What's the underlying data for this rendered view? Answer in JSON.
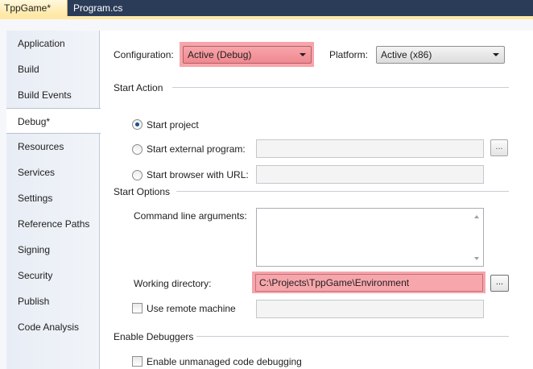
{
  "tabs": [
    {
      "label": "TppGame*",
      "active": true
    },
    {
      "label": "Program.cs",
      "active": false
    }
  ],
  "nav": {
    "items": [
      {
        "label": "Application"
      },
      {
        "label": "Build"
      },
      {
        "label": "Build Events"
      },
      {
        "label": "Debug*",
        "selected": true
      },
      {
        "label": "Resources"
      },
      {
        "label": "Services"
      },
      {
        "label": "Settings"
      },
      {
        "label": "Reference Paths"
      },
      {
        "label": "Signing"
      },
      {
        "label": "Security"
      },
      {
        "label": "Publish"
      },
      {
        "label": "Code Analysis"
      }
    ]
  },
  "config": {
    "configuration_label": "Configuration:",
    "configuration_value": "Active (Debug)",
    "platform_label": "Platform:",
    "platform_value": "Active (x86)"
  },
  "start_action": {
    "title": "Start Action",
    "start_project": "Start project",
    "start_external": "Start external program:",
    "start_browser": "Start browser with URL:",
    "browse_label": "..."
  },
  "start_options": {
    "title": "Start Options",
    "cmd_args_label": "Command line arguments:",
    "cmd_args_value": "",
    "working_dir_label": "Working directory:",
    "working_dir_value": "C:\\Projects\\TppGame\\Environment",
    "browse_label": "...",
    "remote_label": "Use remote machine",
    "remote_value": ""
  },
  "debuggers": {
    "title": "Enable Debuggers",
    "unmanaged_label": "Enable unmanaged code debugging"
  },
  "colors": {
    "highlight": "#f05a64",
    "tab_active": "#ffe7a3",
    "chrome": "#2b3c59"
  }
}
